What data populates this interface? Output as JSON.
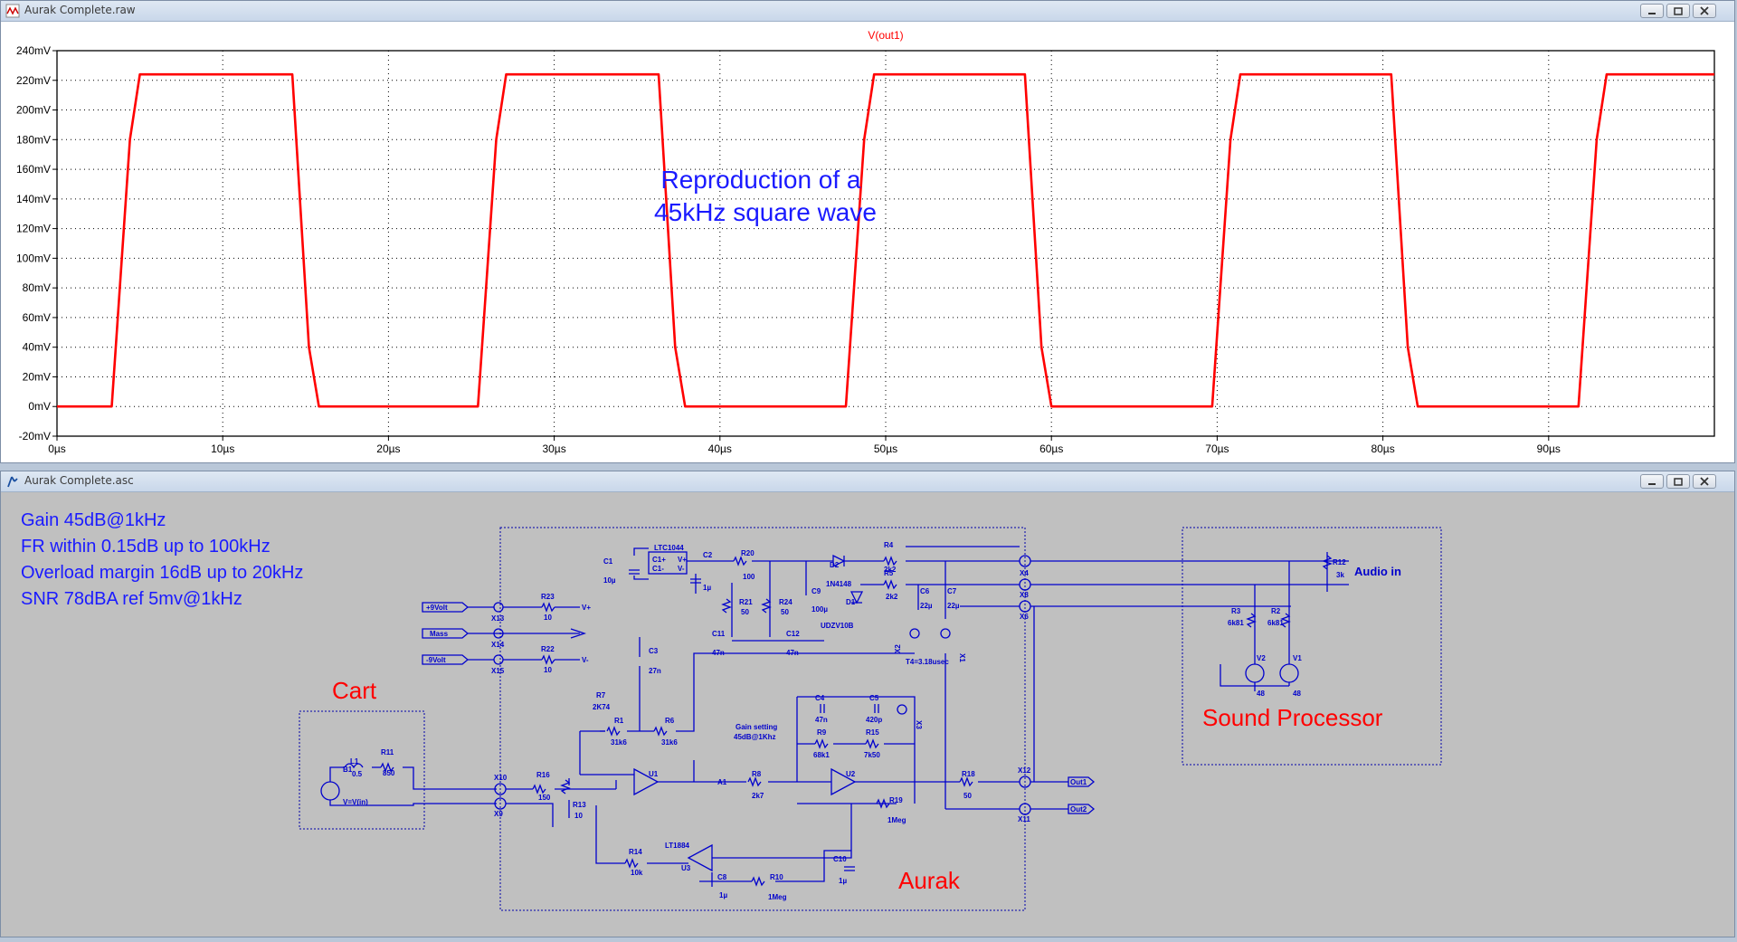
{
  "waveform_window": {
    "title": "Aurak Complete.raw",
    "trace_name": "V(out1)",
    "annotation": [
      "Reproduction of a",
      "45kHz square wave"
    ]
  },
  "schematic_window": {
    "title": "Aurak Complete.asc",
    "specs": [
      "Gain 45dB@1kHz",
      "FR within 0.15dB up to 100kHz",
      "Overload margin 16dB up to 20kHz",
      "SNR 78dBA ref 5mv@1kHz"
    ],
    "blocks": {
      "cart": "Cart",
      "aurak": "Aurak",
      "sound_processor": "Sound Processor"
    },
    "ports": {
      "plus9": "+9Volt",
      "mass": "Mass",
      "minus9": "-9Volt",
      "out1": "Out1",
      "out2": "Out2",
      "audio_in": "Audio in"
    },
    "parts": {
      "C1": "C1",
      "C1v": "10µ",
      "LTC1044": "LTC1044",
      "C1p": "C1+",
      "C1m": "C1-",
      "Vp": "V+",
      "Vm": "V-",
      "C2": "C2",
      "C2v": "1µ",
      "R20": "R20",
      "R20v": "100",
      "R21": "R21",
      "R21v": "50",
      "R24": "R24",
      "R24v": "50",
      "C9": "C9",
      "C9v": "100µ",
      "C11": "C11",
      "C11v": "47n",
      "C12": "C12",
      "C12v": "47n",
      "D2": "D2",
      "D2v": "1N4148",
      "D1": "D1",
      "D1v": "UDZV10B",
      "R4": "R4",
      "R4v": "2k2",
      "R5": "R5",
      "R5v": "2k2",
      "C6": "C6",
      "C6v": "22µ",
      "C7": "C7",
      "C7v": "22µ",
      "X4": "X4",
      "X8": "X8",
      "X6": "X6",
      "X1": "X1",
      "X2": "X2",
      "X13": "X13",
      "X14": "X14",
      "X15": "X15",
      "R23": "R23",
      "R23v": "10",
      "R22": "R22",
      "R22v": "10",
      "C3": "C3",
      "C3v": "27n",
      "R7": "R7",
      "R7v": "2K74",
      "R1": "R1",
      "R1v": "31k6",
      "R6": "R6",
      "R6v": "31k6",
      "T4": "T4=3.18usec",
      "C4": "C4",
      "C4v": "47n",
      "C5": "C5",
      "C5v": "420p",
      "X3": "X3",
      "R9": "R9",
      "R9v": "68k1",
      "R15": "R15",
      "R15v": "7k50",
      "gain1": "Gain setting",
      "gain2": "45dB@1Khz",
      "L1": "L1",
      "L1v": "0.5",
      "R11": "R11",
      "R11v": "850",
      "B1": "B1",
      "B1v": "V=V(in)",
      "X10": "X10",
      "X9": "X9",
      "R16": "R16",
      "R16v": "150",
      "R13": "R13",
      "R13v": "10",
      "U1": "U1",
      "A1": "A1",
      "R8": "R8",
      "R8v": "2k7",
      "U2": "U2",
      "R19": "R19",
      "R19v": "1Meg",
      "R18": "R18",
      "R18v": "50",
      "X12": "X12",
      "X11": "X11",
      "R14": "R14",
      "R14v": "10k",
      "LT1884": "LT1884",
      "U3": "U3",
      "C8": "C8",
      "C8v": "1µ",
      "R10": "R10",
      "R10v": "1Meg",
      "C10": "C10",
      "C10v": "1µ",
      "R12": "R12",
      "R12v": "3k",
      "R3": "R3",
      "R3v": "6k81",
      "R2": "R2",
      "R2v": "6k81",
      "V2": "V2",
      "V2v": "48",
      "V1": "V1",
      "V1v": "48"
    }
  },
  "chart_data": {
    "type": "line",
    "title": "V(out1)",
    "xlabel": "",
    "ylabel": "",
    "x_unit": "µs",
    "y_unit": "mV",
    "xlim": [
      0,
      100
    ],
    "ylim": [
      -20,
      240
    ],
    "x_ticks": [
      "0µs",
      "10µs",
      "20µs",
      "30µs",
      "40µs",
      "50µs",
      "60µs",
      "70µs",
      "80µs",
      "90µs"
    ],
    "y_ticks": [
      "240mV",
      "220mV",
      "200mV",
      "180mV",
      "160mV",
      "140mV",
      "120mV",
      "100mV",
      "80mV",
      "60mV",
      "40mV",
      "20mV",
      "0mV",
      "-20mV"
    ],
    "grid": true,
    "series": [
      {
        "name": "V(out1)",
        "color": "#ff0000",
        "x": [
          0,
          3.3,
          4.4,
          5.0,
          14.2,
          15.2,
          15.8,
          25.4,
          26.5,
          27.1,
          36.3,
          37.3,
          37.9,
          47.6,
          48.7,
          49.3,
          58.4,
          59.4,
          60.0,
          69.7,
          70.8,
          71.4,
          80.5,
          81.5,
          82.1,
          91.8,
          92.9,
          93.5,
          100
        ],
        "y": [
          0,
          0,
          180,
          224,
          224,
          40,
          0,
          0,
          180,
          224,
          224,
          40,
          0,
          0,
          180,
          224,
          224,
          40,
          0,
          0,
          180,
          224,
          224,
          40,
          0,
          0,
          180,
          224,
          224
        ]
      }
    ]
  },
  "colors": {
    "trace": "#ff0000",
    "annotation": "#1a1aff",
    "schematic_wire": "#0000cc",
    "block_label": "#ff0000",
    "spec_text": "#1a1aff"
  }
}
